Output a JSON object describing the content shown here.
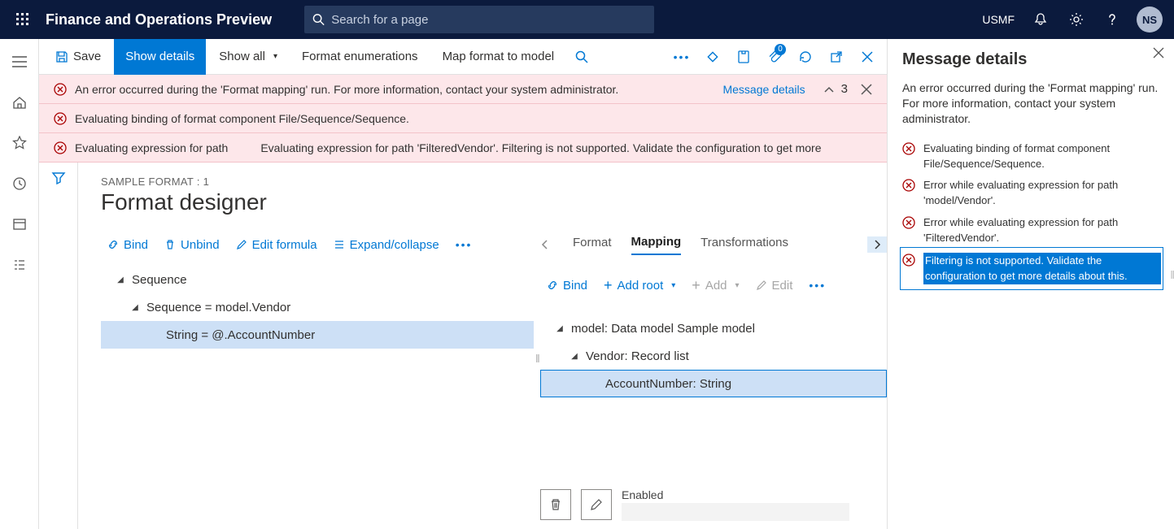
{
  "header": {
    "app_title": "Finance and Operations Preview",
    "search_placeholder": "Search for a page",
    "company": "USMF",
    "avatar": "NS"
  },
  "actionbar": {
    "save": "Save",
    "show_details": "Show details",
    "show_all": "Show all",
    "format_enum": "Format enumerations",
    "map_format": "Map format to model",
    "attachments_badge": "0"
  },
  "errors": {
    "e1": "An error occurred during the 'Format mapping' run. For more information, contact your system administrator.",
    "e1_link": "Message details",
    "e1_count": "3",
    "e2": "Evaluating binding of format component File/Sequence/Sequence.",
    "e3_prefix": "Evaluating expression for path",
    "e3_body": "Evaluating expression for path 'FilteredVendor'. Filtering is not supported. Validate the configuration to get more"
  },
  "designer": {
    "breadcrumb": "SAMPLE FORMAT : 1",
    "title": "Format designer",
    "left_tools": {
      "bind": "Bind",
      "unbind": "Unbind",
      "edit_formula": "Edit formula",
      "expand": "Expand/collapse"
    },
    "left_tree": {
      "n1": "Sequence",
      "n2": "Sequence = model.Vendor",
      "n3": "String = @.AccountNumber"
    },
    "tabs": {
      "format": "Format",
      "mapping": "Mapping",
      "transformations": "Transformations"
    },
    "right_tools": {
      "bind": "Bind",
      "add_root": "Add root",
      "add": "Add",
      "edit": "Edit"
    },
    "right_tree": {
      "r1": "model: Data model Sample model",
      "r2": "Vendor: Record list",
      "r3": "AccountNumber: String"
    },
    "enabled_label": "Enabled"
  },
  "msg_panel": {
    "title": "Message details",
    "body": "An error occurred during the 'Format mapping' run. For more information, contact your system administrator.",
    "items": {
      "m1": "Evaluating binding of format component File/Sequence/Sequence.",
      "m2": "Error while evaluating expression for path 'model/Vendor'.",
      "m3": "Error while evaluating expression for path 'FilteredVendor'.",
      "m4": "Filtering is not supported. Validate the configuration to get more details about this."
    }
  }
}
